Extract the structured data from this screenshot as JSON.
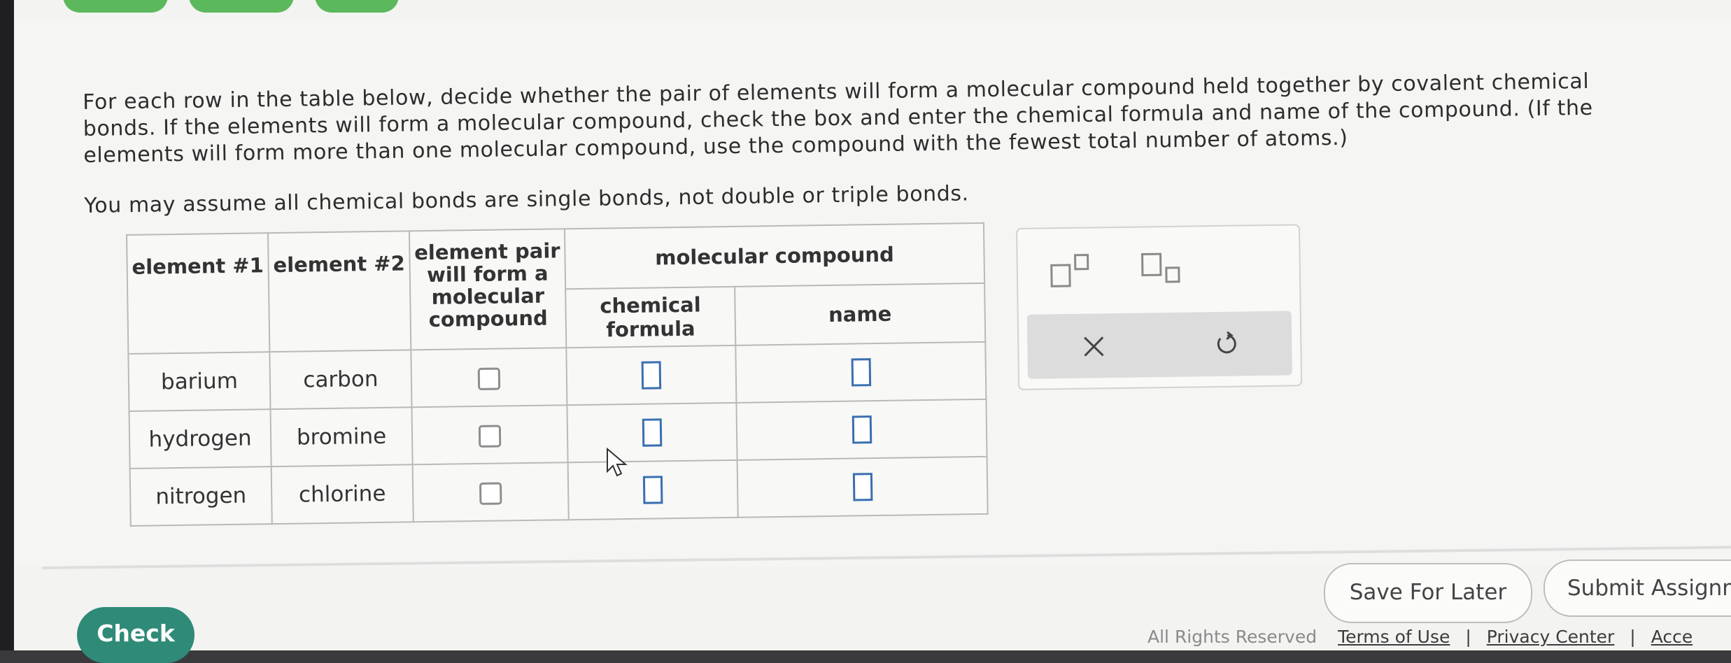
{
  "instructions": {
    "paragraph1": "For each row in the table below, decide whether the pair of elements will form a molecular compound held together by covalent chemical bonds. If the elements will form a molecular compound, check the box and enter the chemical formula and name of the compound. (If the elements will form more than one molecular compound, use the compound with the fewest total number of atoms.)",
    "paragraph2": "You may assume all chemical bonds are single bonds, not double or triple bonds."
  },
  "table": {
    "headers": {
      "element1": "element #1",
      "element2": "element #2",
      "pair": "element pair will form a molecular compound",
      "group": "molecular compound",
      "formula": "chemical formula",
      "name": "name"
    },
    "rows": [
      {
        "element1": "barium",
        "element2": "carbon"
      },
      {
        "element1": "hydrogen",
        "element2": "bromine"
      },
      {
        "element1": "nitrogen",
        "element2": "chlorine"
      }
    ]
  },
  "palette": {
    "superscript_icon": "superscript-icon",
    "subscript_icon": "subscript-icon",
    "clear_icon": "close-icon",
    "undo_icon": "undo-icon"
  },
  "buttons": {
    "check": "Check",
    "save_for_later": "Save For Later",
    "submit": "Submit Assignm"
  },
  "footer": {
    "rights": "All Rights Reserved",
    "terms": "Terms of Use",
    "privacy": "Privacy Center",
    "access": "Acce"
  },
  "colors": {
    "check_button": "#2f8a78",
    "answer_box_border": "#3a6fb0"
  }
}
